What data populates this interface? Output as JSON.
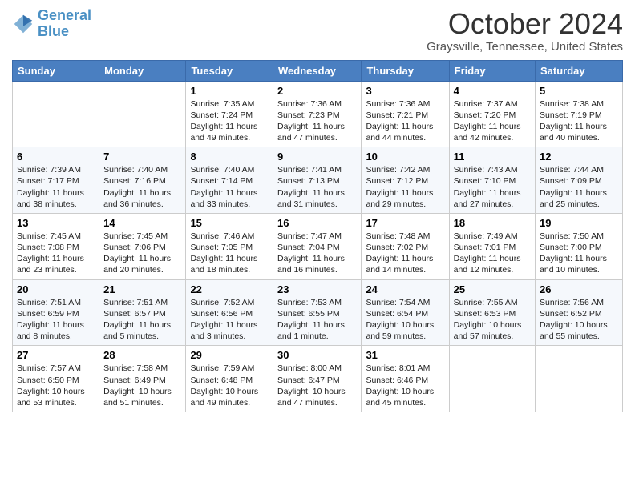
{
  "header": {
    "logo_line1": "General",
    "logo_line2": "Blue",
    "month": "October 2024",
    "location": "Graysville, Tennessee, United States"
  },
  "days_of_week": [
    "Sunday",
    "Monday",
    "Tuesday",
    "Wednesday",
    "Thursday",
    "Friday",
    "Saturday"
  ],
  "weeks": [
    [
      {
        "day": "",
        "text": ""
      },
      {
        "day": "",
        "text": ""
      },
      {
        "day": "1",
        "text": "Sunrise: 7:35 AM\nSunset: 7:24 PM\nDaylight: 11 hours and 49 minutes."
      },
      {
        "day": "2",
        "text": "Sunrise: 7:36 AM\nSunset: 7:23 PM\nDaylight: 11 hours and 47 minutes."
      },
      {
        "day": "3",
        "text": "Sunrise: 7:36 AM\nSunset: 7:21 PM\nDaylight: 11 hours and 44 minutes."
      },
      {
        "day": "4",
        "text": "Sunrise: 7:37 AM\nSunset: 7:20 PM\nDaylight: 11 hours and 42 minutes."
      },
      {
        "day": "5",
        "text": "Sunrise: 7:38 AM\nSunset: 7:19 PM\nDaylight: 11 hours and 40 minutes."
      }
    ],
    [
      {
        "day": "6",
        "text": "Sunrise: 7:39 AM\nSunset: 7:17 PM\nDaylight: 11 hours and 38 minutes."
      },
      {
        "day": "7",
        "text": "Sunrise: 7:40 AM\nSunset: 7:16 PM\nDaylight: 11 hours and 36 minutes."
      },
      {
        "day": "8",
        "text": "Sunrise: 7:40 AM\nSunset: 7:14 PM\nDaylight: 11 hours and 33 minutes."
      },
      {
        "day": "9",
        "text": "Sunrise: 7:41 AM\nSunset: 7:13 PM\nDaylight: 11 hours and 31 minutes."
      },
      {
        "day": "10",
        "text": "Sunrise: 7:42 AM\nSunset: 7:12 PM\nDaylight: 11 hours and 29 minutes."
      },
      {
        "day": "11",
        "text": "Sunrise: 7:43 AM\nSunset: 7:10 PM\nDaylight: 11 hours and 27 minutes."
      },
      {
        "day": "12",
        "text": "Sunrise: 7:44 AM\nSunset: 7:09 PM\nDaylight: 11 hours and 25 minutes."
      }
    ],
    [
      {
        "day": "13",
        "text": "Sunrise: 7:45 AM\nSunset: 7:08 PM\nDaylight: 11 hours and 23 minutes."
      },
      {
        "day": "14",
        "text": "Sunrise: 7:45 AM\nSunset: 7:06 PM\nDaylight: 11 hours and 20 minutes."
      },
      {
        "day": "15",
        "text": "Sunrise: 7:46 AM\nSunset: 7:05 PM\nDaylight: 11 hours and 18 minutes."
      },
      {
        "day": "16",
        "text": "Sunrise: 7:47 AM\nSunset: 7:04 PM\nDaylight: 11 hours and 16 minutes."
      },
      {
        "day": "17",
        "text": "Sunrise: 7:48 AM\nSunset: 7:02 PM\nDaylight: 11 hours and 14 minutes."
      },
      {
        "day": "18",
        "text": "Sunrise: 7:49 AM\nSunset: 7:01 PM\nDaylight: 11 hours and 12 minutes."
      },
      {
        "day": "19",
        "text": "Sunrise: 7:50 AM\nSunset: 7:00 PM\nDaylight: 11 hours and 10 minutes."
      }
    ],
    [
      {
        "day": "20",
        "text": "Sunrise: 7:51 AM\nSunset: 6:59 PM\nDaylight: 11 hours and 8 minutes."
      },
      {
        "day": "21",
        "text": "Sunrise: 7:51 AM\nSunset: 6:57 PM\nDaylight: 11 hours and 5 minutes."
      },
      {
        "day": "22",
        "text": "Sunrise: 7:52 AM\nSunset: 6:56 PM\nDaylight: 11 hours and 3 minutes."
      },
      {
        "day": "23",
        "text": "Sunrise: 7:53 AM\nSunset: 6:55 PM\nDaylight: 11 hours and 1 minute."
      },
      {
        "day": "24",
        "text": "Sunrise: 7:54 AM\nSunset: 6:54 PM\nDaylight: 10 hours and 59 minutes."
      },
      {
        "day": "25",
        "text": "Sunrise: 7:55 AM\nSunset: 6:53 PM\nDaylight: 10 hours and 57 minutes."
      },
      {
        "day": "26",
        "text": "Sunrise: 7:56 AM\nSunset: 6:52 PM\nDaylight: 10 hours and 55 minutes."
      }
    ],
    [
      {
        "day": "27",
        "text": "Sunrise: 7:57 AM\nSunset: 6:50 PM\nDaylight: 10 hours and 53 minutes."
      },
      {
        "day": "28",
        "text": "Sunrise: 7:58 AM\nSunset: 6:49 PM\nDaylight: 10 hours and 51 minutes."
      },
      {
        "day": "29",
        "text": "Sunrise: 7:59 AM\nSunset: 6:48 PM\nDaylight: 10 hours and 49 minutes."
      },
      {
        "day": "30",
        "text": "Sunrise: 8:00 AM\nSunset: 6:47 PM\nDaylight: 10 hours and 47 minutes."
      },
      {
        "day": "31",
        "text": "Sunrise: 8:01 AM\nSunset: 6:46 PM\nDaylight: 10 hours and 45 minutes."
      },
      {
        "day": "",
        "text": ""
      },
      {
        "day": "",
        "text": ""
      }
    ]
  ]
}
